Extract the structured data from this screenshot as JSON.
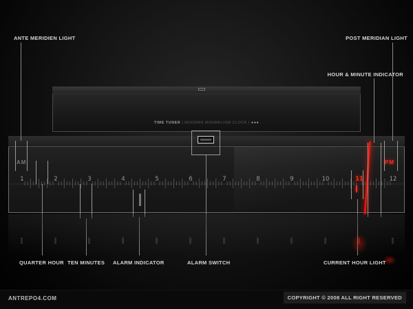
{
  "header": {
    "tuner_title": "TIME TUNER",
    "tuner_sub": "MODERN MINIMALISM CLOCK",
    "tuner_dots": "●●●"
  },
  "clock": {
    "am_label": "AM",
    "pm_label": "PM",
    "hours": [
      "1",
      "2",
      "3",
      "4",
      "5",
      "6",
      "7",
      "8",
      "9",
      "10",
      "11",
      "12"
    ],
    "current_hour": "11",
    "active_period": "PM",
    "accent_color": "#ff2a1a"
  },
  "callouts": {
    "ante_meridien_light": "ANTE MERIDIEN LIGHT",
    "post_meridian_light": "POST MERIDIAN LIGHT",
    "hour_minute_indicator": "HOUR & MINUTE INDICATOR",
    "quarter_hour": "QUARTER HOUR",
    "ten_minutes": "TEN MINUTES",
    "alarm_indicator": "ALARM INDICATOR",
    "alarm_switch": "ALARM SWITCH",
    "current_hour_light": "CURRENT HOUR LIGHT"
  },
  "footer": {
    "site": "ANTREPO4.COM",
    "copyright": "COPYRIGHT © 2008 ALL RIGHT RESERVED"
  }
}
